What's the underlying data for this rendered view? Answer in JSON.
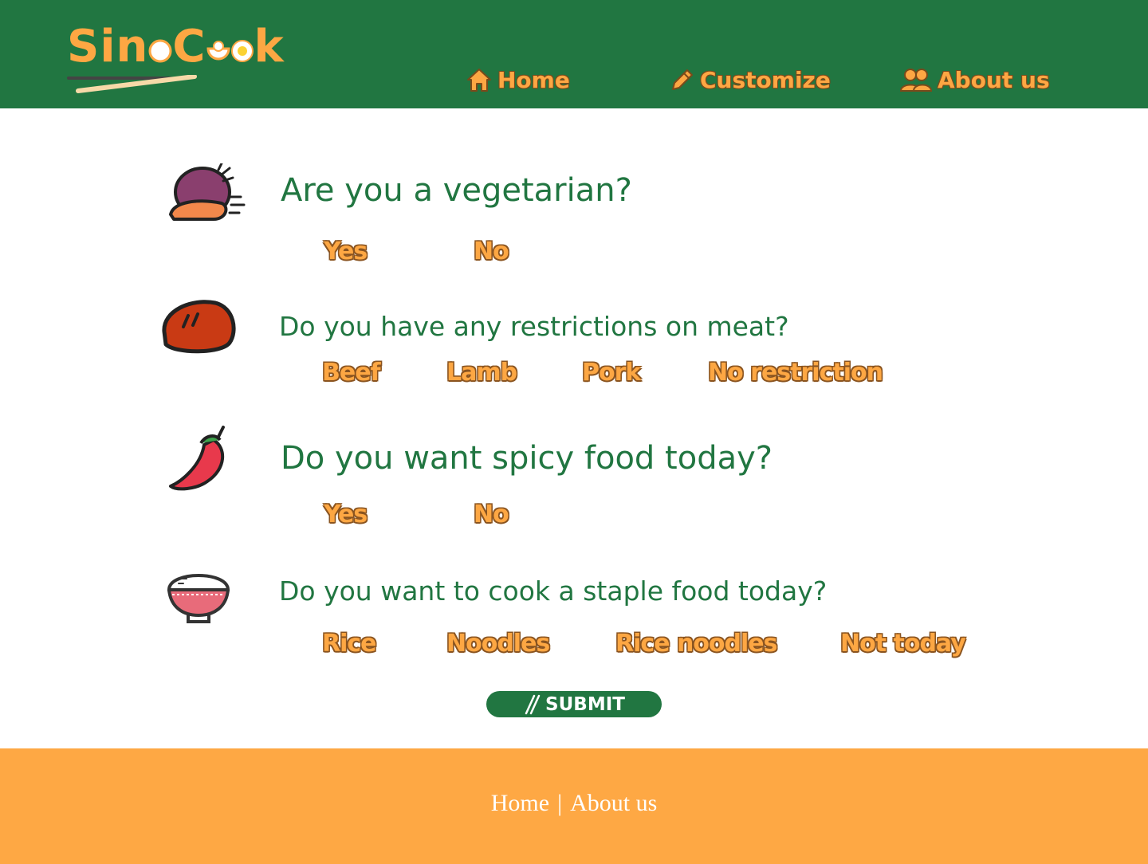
{
  "app": {
    "brand": "SinoCook",
    "colors": {
      "primary_green": "#217641",
      "accent_orange": "#fda743",
      "footer_orange": "#fea844"
    }
  },
  "header": {
    "logo": {
      "text_prefix": "Sin",
      "text_c": "C",
      "text_suffix": "k"
    },
    "nav": [
      {
        "label": "Home",
        "icon": "home-icon"
      },
      {
        "label": "Customize",
        "icon": "pencil-icon"
      },
      {
        "label": "About us",
        "icon": "users-icon"
      }
    ]
  },
  "questions": [
    {
      "icon": "vegetable-icon",
      "text": "Are you a vegetarian?",
      "options": [
        "Yes",
        "No"
      ]
    },
    {
      "icon": "meat-icon",
      "text": "Do you have any restrictions on meat?",
      "options": [
        "Beef",
        "Lamb",
        "Pork",
        "No restriction"
      ]
    },
    {
      "icon": "chili-pepper-icon",
      "text": "Do you want spicy food today?",
      "options": [
        "Yes",
        "No"
      ]
    },
    {
      "icon": "rice-bowl-icon",
      "text": "Do you want to cook a staple food today?",
      "options": [
        "Rice",
        "Noodles",
        "Rice noodles",
        "Not today"
      ]
    }
  ],
  "submit": {
    "label": "SUBMIT",
    "icon": "chopsticks-icon"
  },
  "footer": {
    "links": [
      "Home",
      "About us"
    ],
    "separator": "|"
  }
}
